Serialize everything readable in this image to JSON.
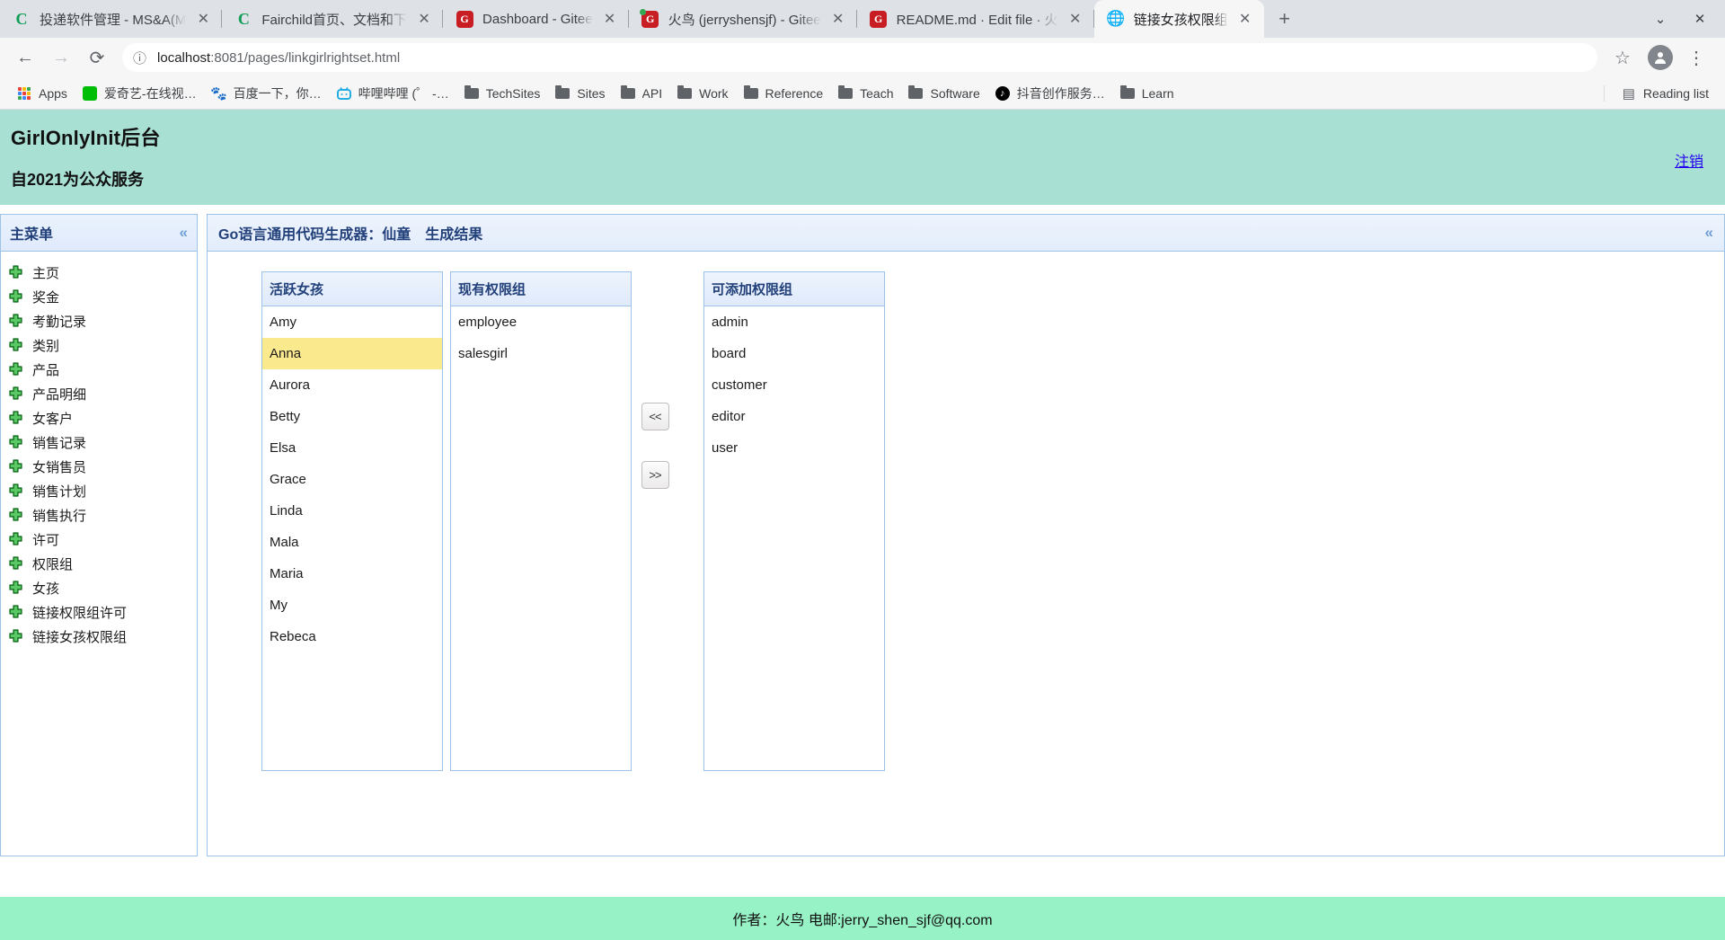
{
  "browser": {
    "tabs": [
      {
        "title": "投递软件管理 - MS&A(M",
        "favicon": "chrome-icon",
        "active": false,
        "loading_dot": false
      },
      {
        "title": "Fairchild首页、文档和下",
        "favicon": "chrome-icon",
        "active": false,
        "loading_dot": false
      },
      {
        "title": "Dashboard - Gitee",
        "favicon": "gitee-icon",
        "active": false,
        "loading_dot": false
      },
      {
        "title": "火鸟 (jerryshensjf) - Gitee",
        "favicon": "gitee-icon",
        "active": false,
        "loading_dot": true
      },
      {
        "title": "README.md · Edit file · 火",
        "favicon": "gitee-icon",
        "active": false,
        "loading_dot": false
      },
      {
        "title": "链接女孩权限组",
        "favicon": "globe-icon",
        "active": true,
        "loading_dot": false
      }
    ],
    "new_tab_label": "+",
    "window_controls": {
      "minimize": "⌄",
      "close": "✕"
    },
    "toolbar": {
      "back": "←",
      "forward": "→",
      "reload": "⟳",
      "site_info_icon": "info-circle-icon",
      "url_host": "localhost",
      "url_path": ":8081/pages/linkgirlrightset.html",
      "bookmark_star": "☆",
      "profile_initial": "👤",
      "menu": "⋮"
    },
    "bookmarks": [
      {
        "label": "Apps",
        "icon": "apps-grid-icon"
      },
      {
        "label": "爱奇艺-在线视…",
        "icon": "iqiyi-icon"
      },
      {
        "label": "百度一下，你…",
        "icon": "baidu-icon"
      },
      {
        "label": "哔哩哔哩 (゜ -…",
        "icon": "bilibili-icon"
      },
      {
        "label": "TechSites",
        "icon": "folder-icon"
      },
      {
        "label": "Sites",
        "icon": "folder-icon"
      },
      {
        "label": "API",
        "icon": "folder-icon"
      },
      {
        "label": "Work",
        "icon": "folder-icon"
      },
      {
        "label": "Reference",
        "icon": "folder-icon"
      },
      {
        "label": "Teach",
        "icon": "folder-icon"
      },
      {
        "label": "Software",
        "icon": "folder-icon"
      },
      {
        "label": "抖音创作服务…",
        "icon": "tiktok-icon"
      },
      {
        "label": "Learn",
        "icon": "folder-icon"
      }
    ],
    "reading_list": {
      "label": "Reading list",
      "icon": "reading-list-icon"
    }
  },
  "site": {
    "title": "GirlOnlyInit后台",
    "subtitle": "自2021为公众服务",
    "logout_label": "注销",
    "header_bg": "#a9e0d4",
    "footer_bg": "#97f2c6",
    "footer_text": "作者：火鸟 电邮:jerry_shen_sjf@qq.com"
  },
  "sidebar": {
    "title": "主菜单",
    "collapse_icon": "«",
    "items": [
      {
        "label": "主页"
      },
      {
        "label": "奖金"
      },
      {
        "label": "考勤记录"
      },
      {
        "label": "类别"
      },
      {
        "label": "产品"
      },
      {
        "label": "产品明细"
      },
      {
        "label": "女客户"
      },
      {
        "label": "销售记录"
      },
      {
        "label": "女销售员"
      },
      {
        "label": "销售计划"
      },
      {
        "label": "销售执行"
      },
      {
        "label": "许可"
      },
      {
        "label": "权限组"
      },
      {
        "label": "女孩"
      },
      {
        "label": "链接权限组许可"
      },
      {
        "label": "链接女孩权限组"
      }
    ]
  },
  "main": {
    "panel_title": "Go语言通用代码生成器：仙童　生成结果",
    "collapse_icon": "«",
    "lists": {
      "girls": {
        "header": "活跃女孩",
        "items": [
          "Amy",
          "Anna",
          "Aurora",
          "Betty",
          "Elsa",
          "Grace",
          "Linda",
          "Mala",
          "Maria",
          "My",
          "Rebeca"
        ],
        "selected": "Anna",
        "selected_bg": "#fbe98e"
      },
      "current_groups": {
        "header": "现有权限组",
        "items": [
          "employee",
          "salesgirl"
        ]
      },
      "available_groups": {
        "header": "可添加权限组",
        "items": [
          "admin",
          "board",
          "customer",
          "editor",
          "user"
        ]
      }
    },
    "transfer": {
      "move_left_label": "<<",
      "move_right_label": ">>"
    }
  }
}
